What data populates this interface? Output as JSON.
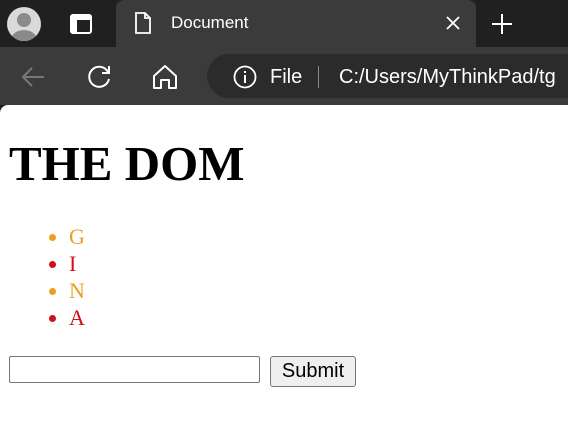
{
  "browser": {
    "tab": {
      "title": "Document"
    },
    "address_bar": {
      "scheme_label": "File",
      "url": "C:/Users/MyThinkPad/tg"
    }
  },
  "page": {
    "heading": "THE DOM",
    "list_items": [
      {
        "text": "G",
        "color": "#e8a020"
      },
      {
        "text": "I",
        "color": "#d0101a"
      },
      {
        "text": "N",
        "color": "#e8a020"
      },
      {
        "text": "A",
        "color": "#d0101a"
      }
    ],
    "form": {
      "input_value": "",
      "submit_label": "Submit"
    }
  }
}
